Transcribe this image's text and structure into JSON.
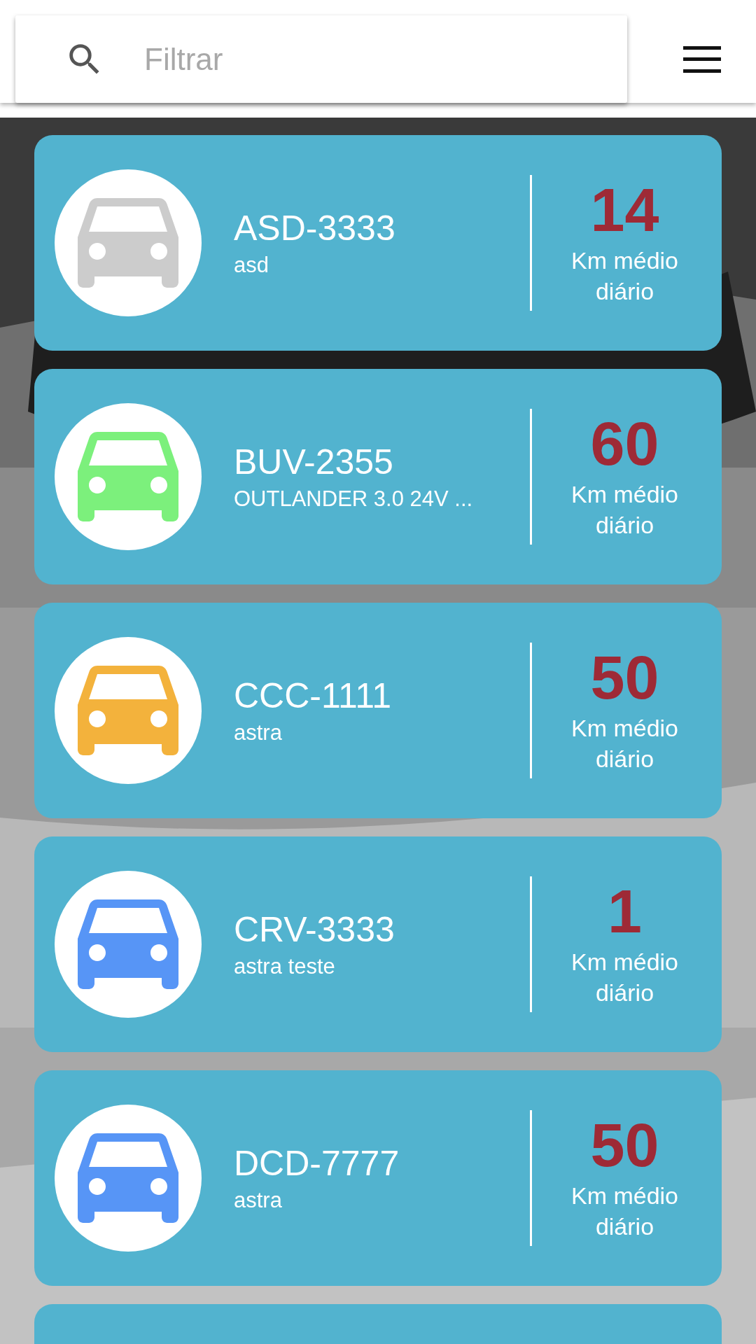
{
  "search": {
    "placeholder": "Filtrar"
  },
  "vehicles": [
    {
      "kind": "card",
      "plate": "ASD-3333",
      "model": "asd",
      "color": "#cccccc",
      "km": "14",
      "km_label": "Km médio diário"
    },
    {
      "kind": "card",
      "plate": "BUV-2355",
      "model": "OUTLANDER 3.0 24V ...",
      "color": "#7cf07c",
      "km": "60",
      "km_label": "Km médio diário"
    },
    {
      "kind": "card",
      "plate": "CCC-1111",
      "model": "astra",
      "color": "#f3b23c",
      "km": "50",
      "km_label": "Km médio diário"
    },
    {
      "kind": "card",
      "plate": "CRV-3333",
      "model": "astra teste",
      "color": "#5795f6",
      "km": "1",
      "km_label": "Km médio diário"
    },
    {
      "kind": "card",
      "plate": "DCD-7777",
      "model": "astra",
      "color": "#5795f6",
      "km": "50",
      "km_label": "Km médio diário"
    },
    {
      "kind": "cut"
    }
  ]
}
